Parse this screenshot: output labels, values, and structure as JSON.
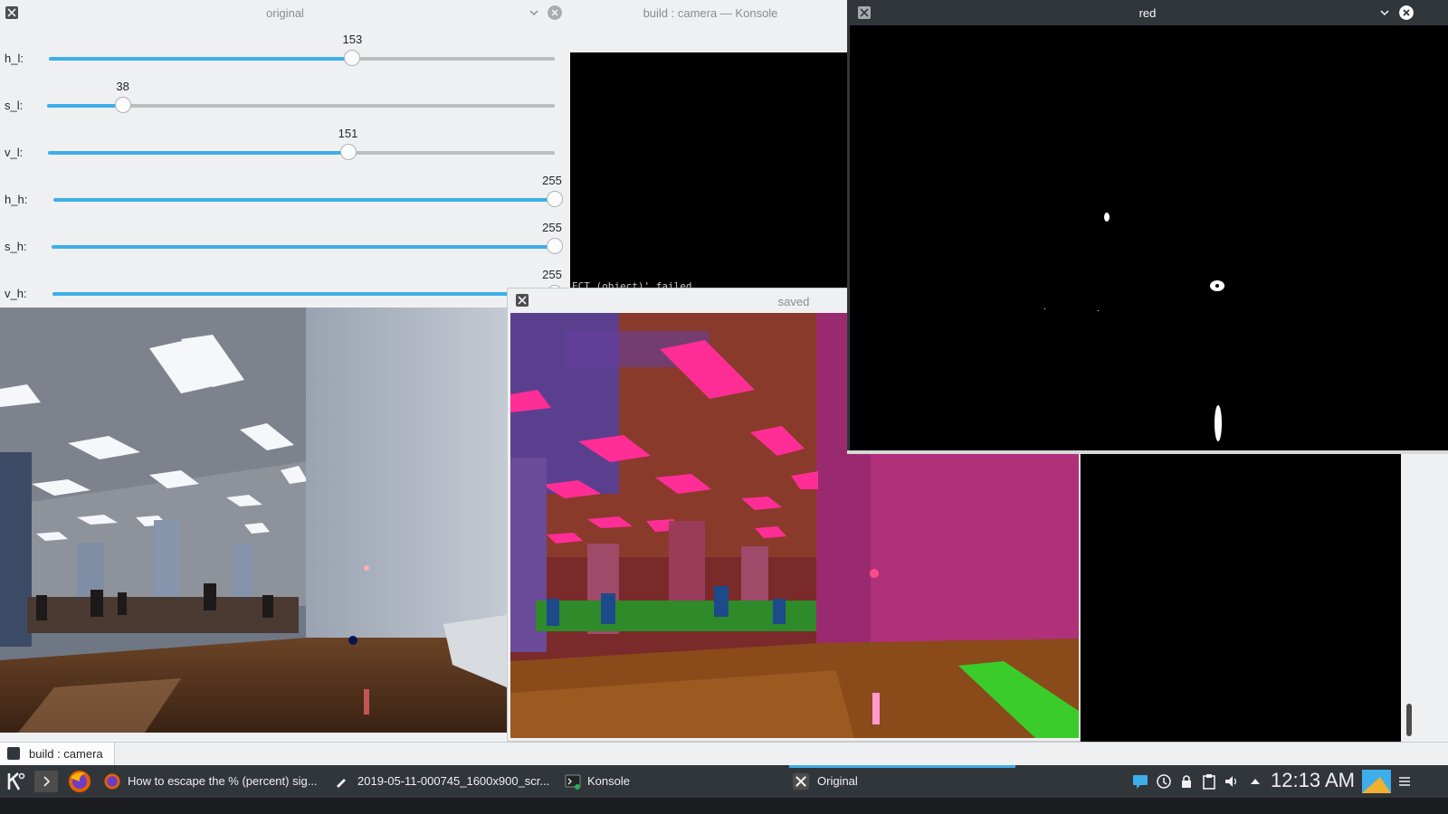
{
  "windows": {
    "original": {
      "title": "original"
    },
    "konsole": {
      "title": "build : camera — Konsole",
      "terminal_text": "ECT (object)' failed"
    },
    "saved": {
      "title": "saved"
    },
    "red": {
      "title": "red"
    }
  },
  "trackbars": [
    {
      "label": "h_l:",
      "value": "153",
      "fraction": 0.6
    },
    {
      "label": "s_l:",
      "value": "38",
      "fraction": 0.149
    },
    {
      "label": "v_l:",
      "value": "151",
      "fraction": 0.592
    },
    {
      "label": "h_h:",
      "value": "255",
      "fraction": 1.0
    },
    {
      "label": "s_h:",
      "value": "255",
      "fraction": 1.0
    },
    {
      "label": "v_h:",
      "value": "255",
      "fraction": 1.0
    }
  ],
  "konsole_tab": {
    "label": "build : camera"
  },
  "taskbar": {
    "tasks": [
      {
        "label": "How to escape the % (percent) sig...",
        "icon": "firefox-icon"
      },
      {
        "label": "2019-05-11-000745_1600x900_scr...",
        "icon": "pen-icon"
      },
      {
        "label": "Konsole",
        "icon": "terminal-icon"
      },
      {
        "label": "Original",
        "icon": "x-app-icon"
      }
    ],
    "clock": "12:13 AM"
  },
  "colors": {
    "accent": "#3daee9",
    "panel": "#31363b",
    "window_bg": "#eff0f1"
  }
}
